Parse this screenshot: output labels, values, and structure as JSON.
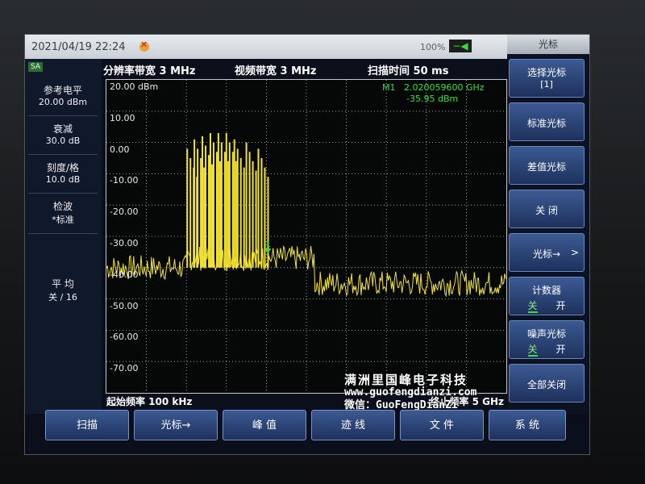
{
  "statusbar": {
    "datetime": "2021/04/19 22:24",
    "battery": "100%",
    "plug": "−◀"
  },
  "top_info": {
    "rbw": "分辨率带宽  3 MHz",
    "vbw": "视频带宽  3 MHz",
    "sweep": "扫描时间  50 ms"
  },
  "left_panel": {
    "mode": "SA",
    "ref_level_label": "参考电平",
    "ref_level_value": "20.00 dBm",
    "atten_label": "衰减",
    "atten_value": "30.0 dB",
    "scale_label": "刻度/格",
    "scale_value": "10.0 dB",
    "detector_label": "检波",
    "detector_value": "*标准",
    "average_label": "平 均",
    "average_value": "关 / 16"
  },
  "y_axis": {
    "labels": [
      "20.00 dBm",
      "10.00",
      "0.00",
      "-10.00",
      "-20.00",
      "-30.00",
      "-40.00",
      "-50.00",
      "-60.00",
      "-70.00"
    ]
  },
  "marker": {
    "name": "M1",
    "freq": "2.020059600 GHz",
    "level": "-35.95 dBm",
    "tag": "1"
  },
  "bottom_freq": {
    "start": "起始频率  100 kHz",
    "stop": "终止频率  5 GHz"
  },
  "softkeys": {
    "title": "光标",
    "select_marker": "选择光标",
    "select_marker_sub": "[1]",
    "normal_marker": "标准光标",
    "delta_marker": "差值光标",
    "off": "关 闭",
    "marker_to": "光标→",
    "counter": "计数器",
    "counter_off": "关",
    "counter_on": "开",
    "noise_marker": "噪声光标",
    "noise_off": "关",
    "noise_on": "开",
    "all_off": "全部关闭"
  },
  "bottom_keys": [
    "扫描",
    "光标→",
    "峰 值",
    "迹 线",
    "文 件",
    "系 统"
  ],
  "watermark": {
    "line1": "满洲里国峰电子科技",
    "line2": "www.guofengdianzi.com",
    "line3": "微信：GuoFengDianZi"
  },
  "chart_data": {
    "type": "line",
    "xlabel": "",
    "ylabel": "",
    "xlim_hz": [
      100000,
      5000000000
    ],
    "ylim": [
      -80,
      20
    ],
    "grid": true,
    "series": [
      {
        "name": "",
        "segments": [
          {
            "x_start_ghz": 0.0,
            "x_end_ghz": 1.0,
            "level_dbm": -40
          },
          {
            "x_start_ghz": 1.0,
            "x_end_ghz": 2.6,
            "level_dbm": -37
          },
          {
            "x_start_ghz": 2.6,
            "x_end_ghz": 5.0,
            "level_dbm": -45
          }
        ],
        "peaks_dbm": [
          {
            "x_ghz": 1.01,
            "y": -2
          },
          {
            "x_ghz": 1.1,
            "y": 1
          },
          {
            "x_ghz": 1.2,
            "y": 2
          },
          {
            "x_ghz": 1.3,
            "y": 3
          },
          {
            "x_ghz": 1.4,
            "y": 3
          },
          {
            "x_ghz": 1.5,
            "y": 3
          },
          {
            "x_ghz": 1.6,
            "y": 1
          },
          {
            "x_ghz": 1.75,
            "y": 0
          },
          {
            "x_ghz": 1.9,
            "y": -2
          }
        ]
      }
    ]
  }
}
